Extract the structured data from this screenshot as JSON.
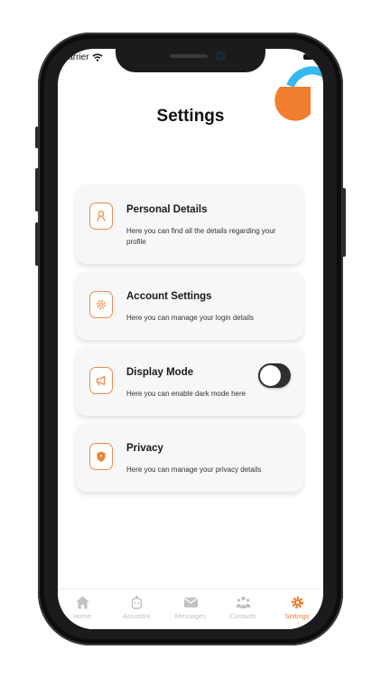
{
  "status_bar": {
    "carrier": "Carrier"
  },
  "page": {
    "title": "Settings"
  },
  "cards": [
    {
      "icon": "user-icon",
      "title": "Personal Details",
      "description": "Here you can find all the details regarding your profile"
    },
    {
      "icon": "gear-icon",
      "title": "Account Settings",
      "description": "Here you can manage your login details"
    },
    {
      "icon": "megaphone-icon",
      "title": "Display Mode",
      "description": "Here you can enable dark mode here",
      "toggle_on": false
    },
    {
      "icon": "shield-icon",
      "title": "Privacy",
      "description": "Here you can manage your privacy details"
    }
  ],
  "tabs": [
    {
      "label": "Home",
      "icon": "home-icon"
    },
    {
      "label": "Assistant",
      "icon": "robot-icon"
    },
    {
      "label": "Messages",
      "icon": "envelope-icon"
    },
    {
      "label": "Contacts",
      "icon": "people-icon"
    },
    {
      "label": "Settings",
      "icon": "gear-icon",
      "active": true
    }
  ],
  "colors": {
    "accent": "#f07e2f",
    "decor_blue": "#35b9f0",
    "tab_inactive": "#c2c2c2"
  }
}
